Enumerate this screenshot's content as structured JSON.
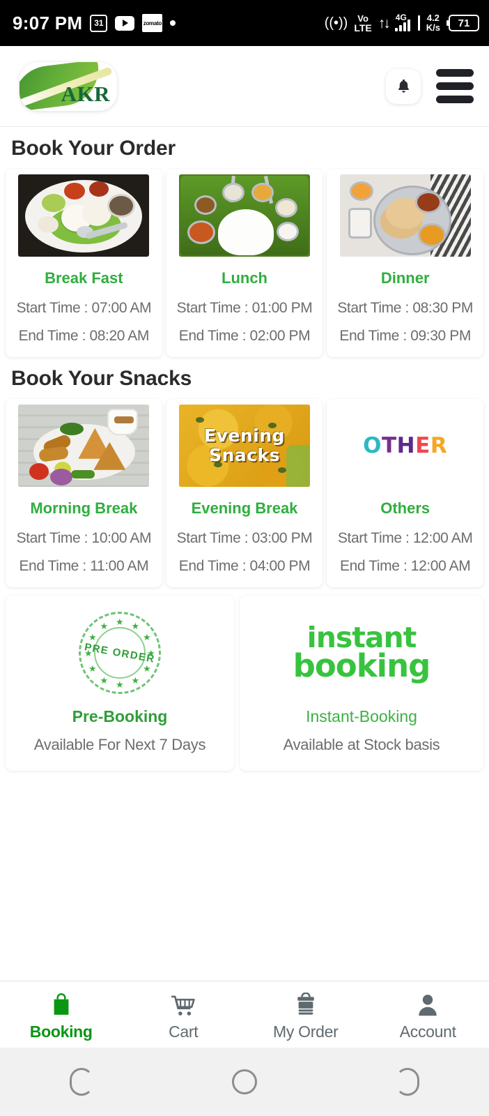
{
  "statusbar": {
    "time": "9:07 PM",
    "calendar_badge": "31",
    "zomato_label": "zomato",
    "volte_top": "Vo",
    "volte_bottom": "LTE",
    "network_type": "4G",
    "data_speed_value": "4.2",
    "data_speed_unit": "K/s",
    "battery_percent": "71"
  },
  "appbar": {
    "logo_text": "AKR"
  },
  "sections": {
    "order_title": "Book Your Order",
    "snacks_title": "Book Your Snacks"
  },
  "meals": [
    {
      "name": "Break Fast",
      "start": "Start Time : 07:00 AM",
      "end": "End Time : 08:20 AM"
    },
    {
      "name": "Lunch",
      "start": "Start Time : 01:00 PM",
      "end": "End Time : 02:00 PM"
    },
    {
      "name": "Dinner",
      "start": "Start Time : 08:30 PM",
      "end": "End Time : 09:30 PM"
    }
  ],
  "snacks": [
    {
      "name": "Morning Break",
      "start": "Start Time : 10:00 AM",
      "end": "End Time : 11:00 AM"
    },
    {
      "name": "Evening Break",
      "start": "Start Time : 03:00 PM",
      "end": "End Time : 04:00 PM"
    },
    {
      "name": "Others",
      "start": "Start Time : 12:00 AM",
      "end": "End Time : 12:00 AM"
    }
  ],
  "snack_art": {
    "evening_line1": "Evening",
    "evening_line2": "Snacks",
    "other_letters": [
      {
        "ch": "O",
        "color": "#2bb8c6"
      },
      {
        "ch": "T",
        "color": "#7a2d8f"
      },
      {
        "ch": "H",
        "color": "#5a2b8c"
      },
      {
        "ch": "E",
        "color": "#ef484e"
      },
      {
        "ch": "R",
        "color": "#f5a623"
      }
    ]
  },
  "booking": [
    {
      "art": "pre-order-stamp",
      "stamp_text": "PRE ORDER",
      "name": "Pre-Booking",
      "sub": "Available For Next 7 Days"
    },
    {
      "art": "instant-booking-wordmark",
      "wordmark_line1": "instant",
      "wordmark_line2": "booking",
      "name": "Instant-Booking",
      "sub": "Available at Stock basis"
    }
  ],
  "bottom_nav": [
    {
      "label": "Booking",
      "icon": "shopping-bag-icon",
      "active": true
    },
    {
      "label": "Cart",
      "icon": "shopping-cart-icon",
      "active": false
    },
    {
      "label": "My Order",
      "icon": "tiffin-box-icon",
      "active": false
    },
    {
      "label": "Account",
      "icon": "person-icon",
      "active": false
    }
  ],
  "colors": {
    "accent_green": "#2fae3f",
    "active_green": "#0a9612",
    "muted_text": "#6d6d6d"
  }
}
